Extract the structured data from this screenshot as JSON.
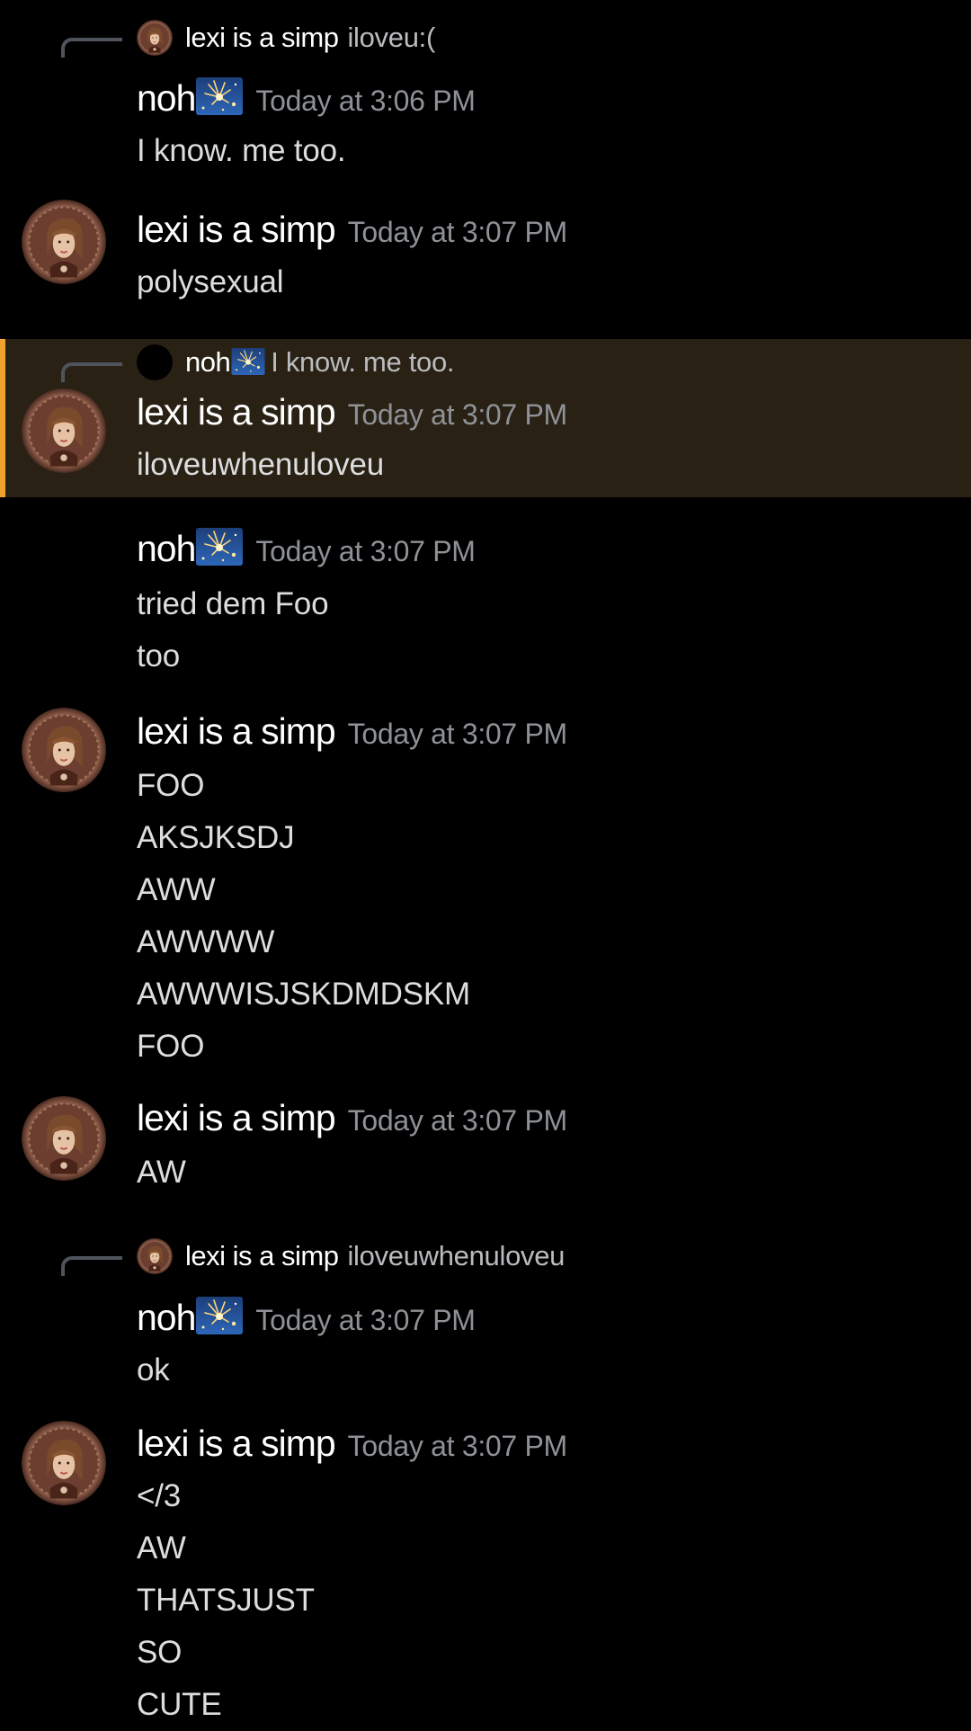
{
  "colors": {
    "background": "#000000",
    "mention_highlight": "#2a2115",
    "mention_bar": "#f0a32c",
    "username": "#ffffff",
    "timestamp": "#8e9297",
    "message_text": "#dcddde"
  },
  "icons": {
    "avatar_lexi": "portrait-avatar-icon",
    "avatar_noh": "black-circle-avatar-icon",
    "noh_emoji": "sparkler-night-sky-emoji-icon",
    "reply_spine": "reply-connector-icon"
  },
  "messages": [
    {
      "reply": {
        "author": "lexi is a simp",
        "content": "iloveu:("
      },
      "author": "noh",
      "time": "Today at 3:06 PM",
      "lines": [
        "I know. me too."
      ]
    },
    {
      "author": "lexi is a simp",
      "time": "Today at 3:07 PM",
      "lines": [
        "polysexual"
      ]
    },
    {
      "reply": {
        "author": "noh",
        "content": "I know. me too."
      },
      "author": "lexi is a simp",
      "time": "Today at 3:07 PM",
      "lines": [
        "iloveuwhenuloveu"
      ],
      "highlighted": true
    },
    {
      "author": "noh",
      "time": "Today at 3:07 PM",
      "lines": [
        "tried dem Foo",
        "too"
      ]
    },
    {
      "author": "lexi is a simp",
      "time": "Today at 3:07 PM",
      "lines": [
        "FOO",
        "AKSJKSDJ",
        "AWW",
        "AWWWW",
        "AWWWISJSKDMDSKM",
        "FOO"
      ]
    },
    {
      "author": "lexi is a simp",
      "time": "Today at 3:07 PM",
      "lines": [
        "AW"
      ]
    },
    {
      "reply": {
        "author": "lexi is a simp",
        "content": "iloveuwhenuloveu"
      },
      "author": "noh",
      "time": "Today at 3:07 PM",
      "lines": [
        "ok"
      ]
    },
    {
      "author": "lexi is a simp",
      "time": "Today at 3:07 PM",
      "lines": [
        "</3",
        "AW",
        "THATSJUST",
        "SO",
        "CUTE"
      ]
    }
  ]
}
